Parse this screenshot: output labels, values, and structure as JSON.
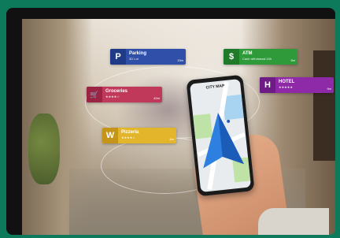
{
  "phone": {
    "map_title": "CITY MAP"
  },
  "tags": [
    {
      "key": "parking",
      "icon": "P",
      "name": "Parking",
      "sub": "3D Lot",
      "dist": "15m",
      "color": "#2f4fa8",
      "icon_bg": "#1f3b88"
    },
    {
      "key": "atm",
      "icon": "$",
      "name": "ATM",
      "sub": "Cash withdrawal 24h",
      "dist": "5m",
      "color": "#2e9a3a",
      "icon_bg": "#1f7a2a"
    },
    {
      "key": "hotel",
      "icon": "H",
      "name": "HOTEL",
      "sub": "★★★★★",
      "dist": "9m",
      "color": "#8e2aa8",
      "icon_bg": "#6c1c84"
    },
    {
      "key": "groceries",
      "icon": "🛒",
      "name": "Groceries",
      "sub": "★★★★☆",
      "dist": "40m",
      "color": "#c0395a",
      "icon_bg": "#9b2444"
    },
    {
      "key": "pizzeria",
      "icon": "W",
      "name": "Pizzeria",
      "sub": "★★★★☆",
      "dist": "8m",
      "color": "#e2b52a",
      "icon_bg": "#c5951a"
    }
  ]
}
